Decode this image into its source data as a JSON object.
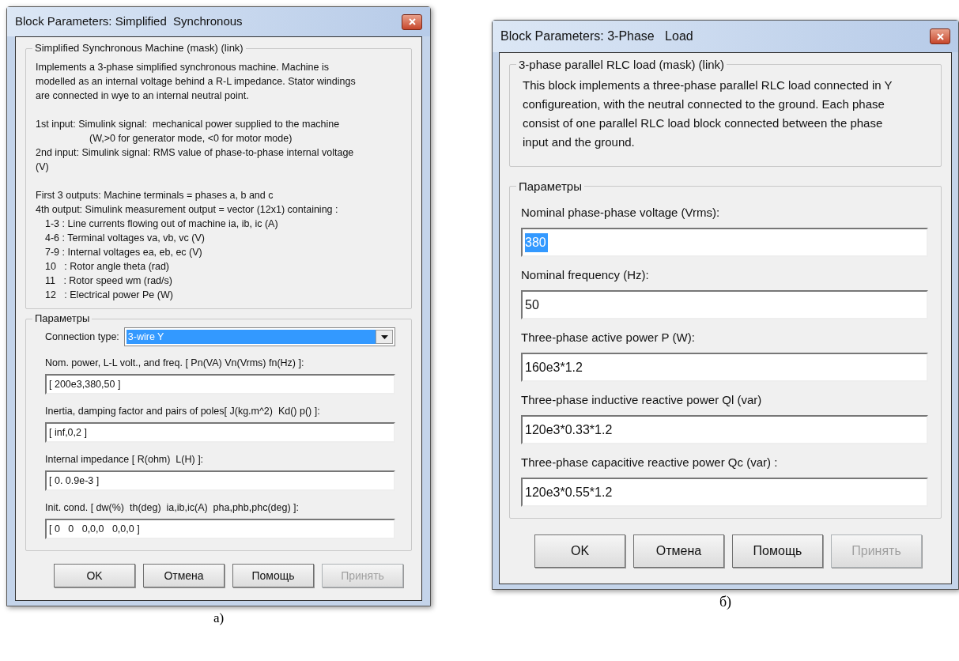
{
  "dialogs": [
    {
      "title": "Block Parameters: Simplified  Synchronous",
      "kind": "small",
      "groups": [
        {
          "kind": "description",
          "title": "Simplified Synchronous Machine (mask) (link)",
          "paragraphs": [
            [
              {
                "kind": "plain",
                "text": "Implements a 3-phase simplified synchronous machine. Machine is"
              },
              {
                "kind": "plain",
                "text": "modelled as an internal voltage behind a R-L impedance. Stator windings"
              },
              {
                "kind": "plain",
                "text": "are connected in wye to an internal neutral point."
              }
            ],
            [
              {
                "kind": "plain",
                "text": "1st input: Simulink signal:  mechanical power supplied to the machine"
              },
              {
                "kind": "deep",
                "text": "(W,>0 for generator mode, <0 for motor mode)"
              },
              {
                "kind": "plain",
                "text": "2nd input: Simulink signal: RMS value of phase-to-phase internal voltage"
              },
              {
                "kind": "plain",
                "text": "(V)"
              }
            ],
            [
              {
                "kind": "plain",
                "text": "First 3 outputs: Machine terminals = phases a, b and c"
              },
              {
                "kind": "plain",
                "text": "4th output: Simulink measurement output = vector (12x1) containing :"
              },
              {
                "kind": "indented",
                "text": "1-3 : Line currents flowing out of machine ia, ib, ic (A)"
              },
              {
                "kind": "indented",
                "text": "4-6 : Terminal voltages va, vb, vc (V)"
              },
              {
                "kind": "indented",
                "text": "7-9 : Internal voltages ea, eb, ec (V)"
              },
              {
                "kind": "indented",
                "text": "10   : Rotor angle theta (rad)"
              },
              {
                "kind": "indented",
                "text": "11   : Rotor speed wm (rad/s)"
              },
              {
                "kind": "indented",
                "text": "12   : Electrical power Pe (W)"
              }
            ]
          ]
        },
        {
          "kind": "parameters",
          "title": "Параметры",
          "params": [
            {
              "kind": "combo",
              "label": "Connection type:",
              "value": "3-wire Y",
              "highlighted": true
            },
            {
              "kind": "field",
              "label": "Nom. power, L-L volt., and freq. [ Pn(VA) Vn(Vrms) fn(Hz) ]:",
              "value": "[ 200e3,380,50 ]",
              "highlighted": false
            },
            {
              "kind": "field",
              "label": "Inertia, damping factor and pairs of poles[ J(kg.m^2)  Kd() p() ]:",
              "value": "[ inf,0,2 ]",
              "highlighted": false
            },
            {
              "kind": "field",
              "label": "Internal impedance [ R(ohm)  L(H) ]:",
              "value": "[ 0. 0.9e-3 ]",
              "highlighted": false
            },
            {
              "kind": "field",
              "label": "Init. cond. [ dw(%)  th(deg)  ia,ib,ic(A)  pha,phb,phc(deg) ]:",
              "value": "[ 0   0   0,0,0   0,0,0 ]",
              "highlighted": false
            }
          ]
        }
      ],
      "buttons": [
        {
          "label": "OK",
          "disabled": false
        },
        {
          "label": "Отмена",
          "disabled": false
        },
        {
          "label": "Помощь",
          "disabled": false
        },
        {
          "label": "Принять",
          "disabled": true
        }
      ],
      "caption": "а)"
    },
    {
      "title": "Block Parameters: 3-Phase   Load",
      "kind": "large",
      "groups": [
        {
          "kind": "description",
          "title": "3-phase parallel RLC load  (mask) (link)",
          "paragraphs": [
            [
              {
                "kind": "plain",
                "text": "This block implements a three-phase parallel RLC load connected in Y"
              },
              {
                "kind": "plain",
                "text": "configureation, with the neutral connected to the ground. Each phase"
              },
              {
                "kind": "plain",
                "text": "consist of one parallel RLC load block connected between the phase"
              },
              {
                "kind": "plain",
                "text": "input and the ground."
              }
            ]
          ]
        },
        {
          "kind": "parameters",
          "title": "Параметры",
          "params": [
            {
              "kind": "field",
              "label": "Nominal phase-phase voltage (Vrms):",
              "value": "380",
              "highlighted": true
            },
            {
              "kind": "field",
              "label": "Nominal frequency (Hz):",
              "value": "50",
              "highlighted": false
            },
            {
              "kind": "field",
              "label": "Three-phase active power P (W):",
              "value": "160e3*1.2",
              "highlighted": false
            },
            {
              "kind": "field",
              "label": "Three-phase inductive reactive power Ql (var)",
              "value": "120e3*0.33*1.2",
              "highlighted": false
            },
            {
              "kind": "field",
              "label": "Three-phase capacitive reactive power Qc (var) :",
              "value": "120e3*0.55*1.2",
              "highlighted": false
            }
          ]
        }
      ],
      "buttons": [
        {
          "label": "OK",
          "disabled": false
        },
        {
          "label": "Отмена",
          "disabled": false
        },
        {
          "label": "Помощь",
          "disabled": false
        },
        {
          "label": "Принять",
          "disabled": true
        }
      ],
      "caption": "б)"
    }
  ]
}
